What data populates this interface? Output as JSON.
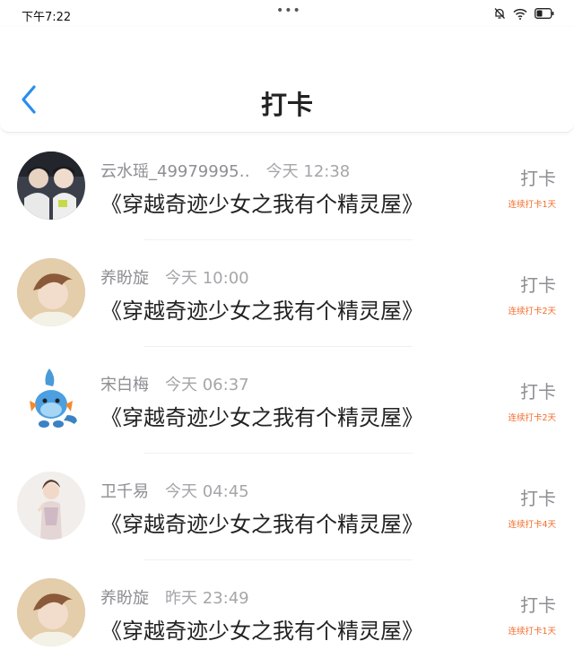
{
  "status_bar": {
    "time": "下午7:22",
    "dots": "•••",
    "icons": [
      "mute-bell-icon",
      "wifi-icon",
      "battery-icon"
    ]
  },
  "header": {
    "title": "打卡",
    "back_icon": "chevron-left-icon",
    "accent_color": "#2a8cf0"
  },
  "rows": [
    {
      "name": "云水瑶_49979995‥",
      "time": "今天 12:38",
      "book": "《穿越奇迹少女之我有个精灵屋》",
      "action": "打卡",
      "streak": "连续打卡1天"
    },
    {
      "name": "养盼旋",
      "time": "今天 10:00",
      "book": "《穿越奇迹少女之我有个精灵屋》",
      "action": "打卡",
      "streak": "连续打卡2天"
    },
    {
      "name": "宋白梅",
      "time": "今天 06:37",
      "book": "《穿越奇迹少女之我有个精灵屋》",
      "action": "打卡",
      "streak": "连续打卡2天"
    },
    {
      "name": "卫千易",
      "time": "今天 04:45",
      "book": "《穿越奇迹少女之我有个精灵屋》",
      "action": "打卡",
      "streak": "连续打卡4天"
    },
    {
      "name": "养盼旋",
      "time": "昨天 23:49",
      "book": "《穿越奇迹少女之我有个精灵屋》",
      "action": "打卡",
      "streak": "连续打卡1天"
    }
  ],
  "colors": {
    "streak": "#f26b2a",
    "muted_text": "#8e8e93"
  }
}
